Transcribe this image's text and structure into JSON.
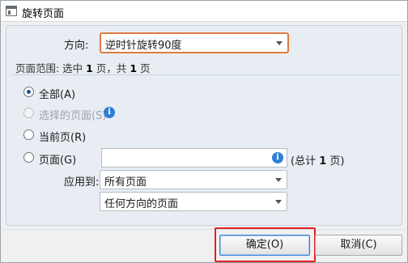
{
  "dialog": {
    "title": "旋转页面",
    "icon": "window-icon"
  },
  "direction": {
    "label": "方向:",
    "selected": "逆时针旋转90度"
  },
  "page_range": {
    "prefix": "页面范围: 选中",
    "selected_count": "1",
    "mid": "页，共",
    "total_count": "1",
    "suffix": "页"
  },
  "options": {
    "all": "全部(A)",
    "selected_pages": "选择的页面(S)",
    "current_page": "当前页(R)",
    "pages": "页面(G)",
    "checked": "all"
  },
  "pages_input": {
    "value": "",
    "total_prefix": "(总计",
    "total_value": "1",
    "total_suffix": "页)"
  },
  "apply_to": {
    "label": "应用到:",
    "pages_selected": "所有页面",
    "orientation_selected": "任何方向的页面"
  },
  "buttons": {
    "ok": "确定(O)",
    "cancel": "取消(C)"
  },
  "colors": {
    "highlight_border": "#e07a3f",
    "annotation_red": "#e02020",
    "info_blue": "#2e7fd6"
  }
}
